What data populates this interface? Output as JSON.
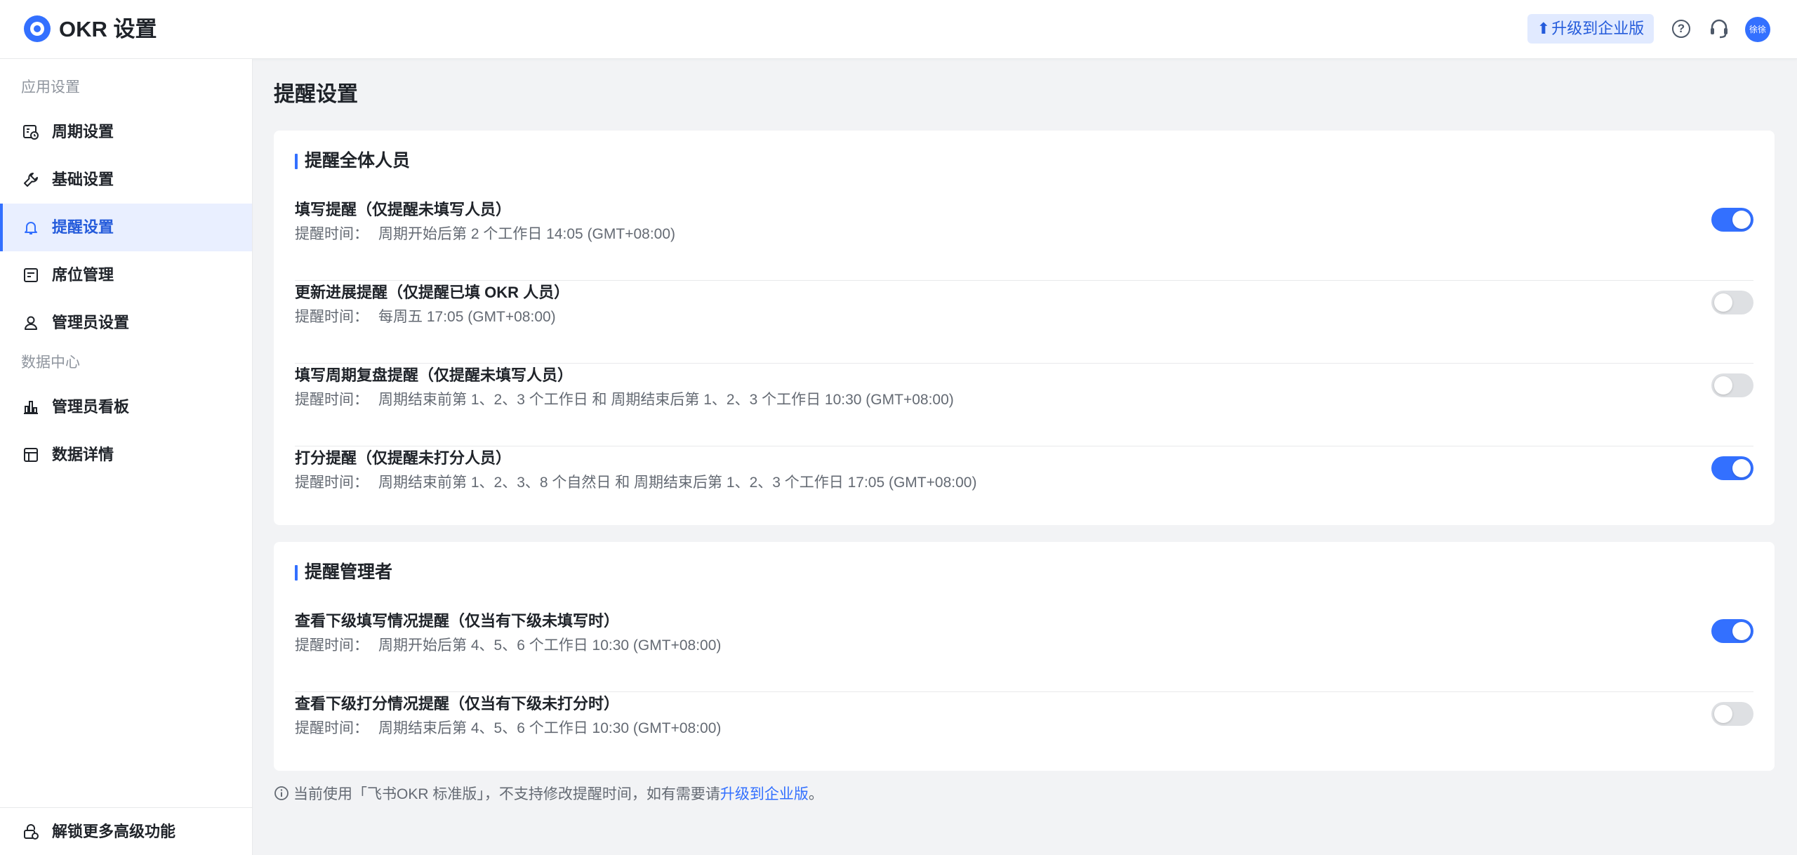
{
  "header": {
    "title": "OKR 设置",
    "upgrade_label": "升级到企业版",
    "avatar_text": "徐徐",
    "accent_color": "#3370ff"
  },
  "sidebar": {
    "groups": [
      {
        "label": "应用设置",
        "items": [
          {
            "label": "周期设置",
            "icon": "calendar-clock-icon",
            "active": false
          },
          {
            "label": "基础设置",
            "icon": "wrench-icon",
            "active": false
          },
          {
            "label": "提醒设置",
            "icon": "bell-icon",
            "active": true
          },
          {
            "label": "席位管理",
            "icon": "seat-icon",
            "active": false
          },
          {
            "label": "管理员设置",
            "icon": "person-icon",
            "active": false
          }
        ]
      },
      {
        "label": "数据中心",
        "items": [
          {
            "label": "管理员看板",
            "icon": "bar-chart-icon",
            "active": false
          },
          {
            "label": "数据详情",
            "icon": "table-icon",
            "active": false
          }
        ]
      }
    ],
    "footer_label": "解锁更多高级功能"
  },
  "main": {
    "page_title": "提醒设置",
    "time_label": "提醒时间：",
    "sections": [
      {
        "title": "提醒全体人员",
        "items": [
          {
            "title": "填写提醒（仅提醒未填写人员）",
            "time": "周期开始后第 2 个工作日 14:05 (GMT+08:00)",
            "enabled": true
          },
          {
            "title": "更新进展提醒（仅提醒已填 OKR 人员）",
            "time": "每周五 17:05 (GMT+08:00)",
            "enabled": false
          },
          {
            "title": "填写周期复盘提醒（仅提醒未填写人员）",
            "time": "周期结束前第 1、2、3 个工作日 和 周期结束后第 1、2、3 个工作日 10:30 (GMT+08:00)",
            "enabled": false
          },
          {
            "title": "打分提醒（仅提醒未打分人员）",
            "time": "周期结束前第 1、2、3、8 个自然日 和 周期结束后第 1、2、3 个工作日 17:05 (GMT+08:00)",
            "enabled": true
          }
        ]
      },
      {
        "title": "提醒管理者",
        "items": [
          {
            "title": "查看下级填写情况提醒（仅当有下级未填写时）",
            "time": "周期开始后第 4、5、6 个工作日 10:30 (GMT+08:00)",
            "enabled": true
          },
          {
            "title": "查看下级打分情况提醒（仅当有下级未打分时）",
            "time": "周期结束后第 4、5、6 个工作日 10:30 (GMT+08:00)",
            "enabled": false
          }
        ]
      }
    ],
    "footer_note": {
      "text": "当前使用「飞书OKR 标准版」，不支持修改提醒时间，如有需要请",
      "link": "升级到企业版",
      "suffix": "。"
    }
  }
}
